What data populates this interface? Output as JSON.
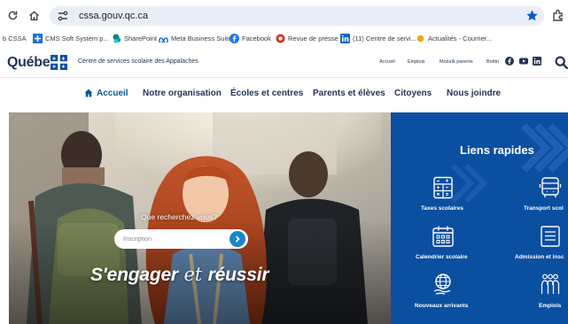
{
  "browser": {
    "url": "cssa.gouv.qc.ca",
    "bookmarks": [
      {
        "label": "b CSSA",
        "icon": "none"
      },
      {
        "label": "CMS Soft System p...",
        "icon": "cms-logo-icon"
      },
      {
        "label": "SharePoint",
        "icon": "sharepoint-icon"
      },
      {
        "label": "Meta Business Suite",
        "icon": "meta-icon"
      },
      {
        "label": "Facebook",
        "icon": "facebook-icon"
      },
      {
        "label": "Revue de presse",
        "icon": "news-icon"
      },
      {
        "label": "(11) Centre de servi...",
        "icon": "linkedin-icon"
      },
      {
        "label": "Actualités - Courrier...",
        "icon": "courrier-icon"
      }
    ]
  },
  "site": {
    "wordmark": "Québec",
    "org_name": "Centre de services scolaire des Appalaches",
    "utility_links": [
      "Accueil",
      "Emplois",
      "Mozaïk parents",
      "Bottin"
    ],
    "social": [
      "facebook-icon",
      "youtube-icon",
      "linkedin-icon"
    ],
    "nav": [
      "Accueil",
      "Notre organisation",
      "Écoles et centres",
      "Parents et élèves",
      "Citoyens",
      "Nous joindre"
    ],
    "active_nav": "Accueil"
  },
  "hero": {
    "question": "Que recherchez-vous?",
    "search_placeholder": "Inscription",
    "slogan_part1": "S'engager",
    "slogan_et": "et",
    "slogan_part2": "réussir"
  },
  "quick_links": {
    "title": "Liens rapides",
    "items": [
      {
        "label": "Taxes scolaires",
        "icon": "calculator-icon"
      },
      {
        "label": "Transport scol",
        "icon": "bus-icon"
      },
      {
        "label": "Calendrier scolaire",
        "icon": "calendar-icon"
      },
      {
        "label": "Admission et insc",
        "icon": "form-icon"
      },
      {
        "label": "Nouveaux arrivants",
        "icon": "globe-hand-icon"
      },
      {
        "label": "Emplois",
        "icon": "people-icon"
      }
    ]
  },
  "colors": {
    "brand_dark": "#223654",
    "link_blue": "#095797",
    "quick_bg": "#0b4fa0",
    "search_go": "#1a86c9"
  }
}
